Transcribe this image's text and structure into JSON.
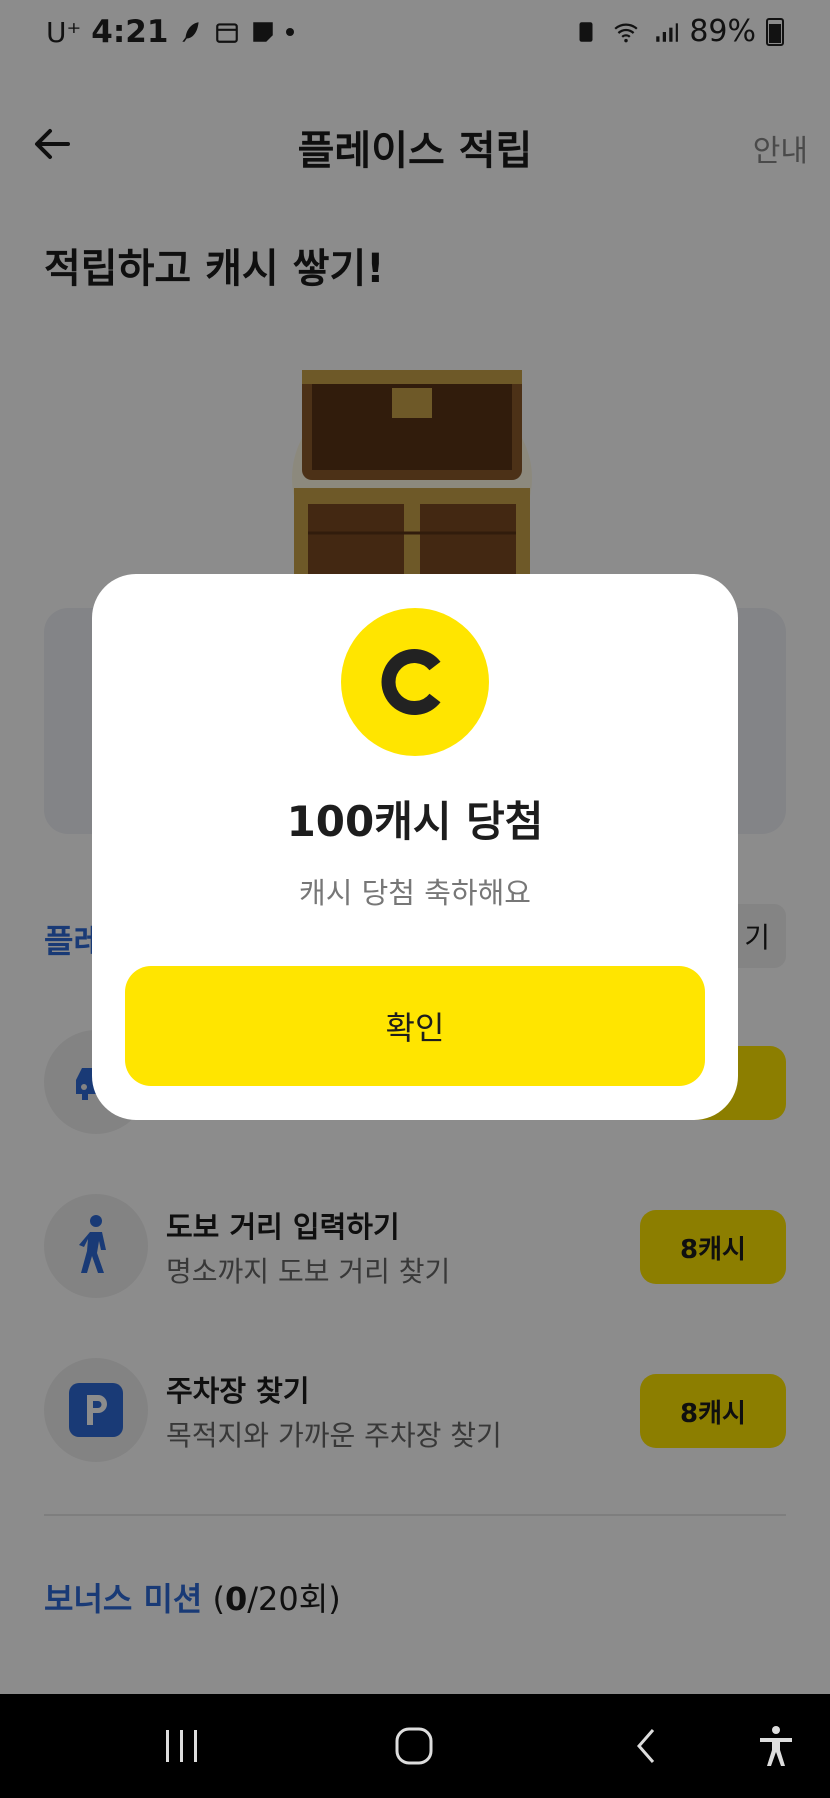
{
  "status_bar": {
    "carrier": "U⁺",
    "time": "4:21",
    "battery_percent": "89%",
    "icons": [
      "feather-icon",
      "calendar-icon",
      "note-icon",
      "dot-icon",
      "battery-saver-icon",
      "wifi-icon",
      "signal-icon",
      "battery-icon"
    ]
  },
  "header": {
    "title": "플레이스 적립",
    "guide_label": "안내",
    "back_icon": "back-arrow-icon"
  },
  "hero": {
    "title": "적립하고 캐시 쌓기!"
  },
  "section": {
    "label": "플레",
    "sort_label": "기"
  },
  "missions": [
    {
      "title": "",
      "subtitle": "",
      "reward": "",
      "icon": "car-icon"
    },
    {
      "title": "도보 거리 입력하기",
      "subtitle": "명소까지 도보 거리 찾기",
      "reward": "8캐시",
      "icon": "walking-person-icon"
    },
    {
      "title": "주차장 찾기",
      "subtitle": "목적지와 가까운 주차장 찾기",
      "reward": "8캐시",
      "icon": "parking-icon"
    }
  ],
  "bonus": {
    "label": "보너스 미션",
    "count_open": "(",
    "count_done": "0",
    "count_rest": "/20회)"
  },
  "modal": {
    "coin_letter": "C",
    "title": "100캐시 당첨",
    "subtitle": "캐시 당첨 축하해요",
    "confirm_label": "확인"
  },
  "colors": {
    "accent_yellow": "#ffe500",
    "link_blue": "#2e6bd8",
    "dim_overlay": "rgba(0,0,0,0.45)"
  }
}
